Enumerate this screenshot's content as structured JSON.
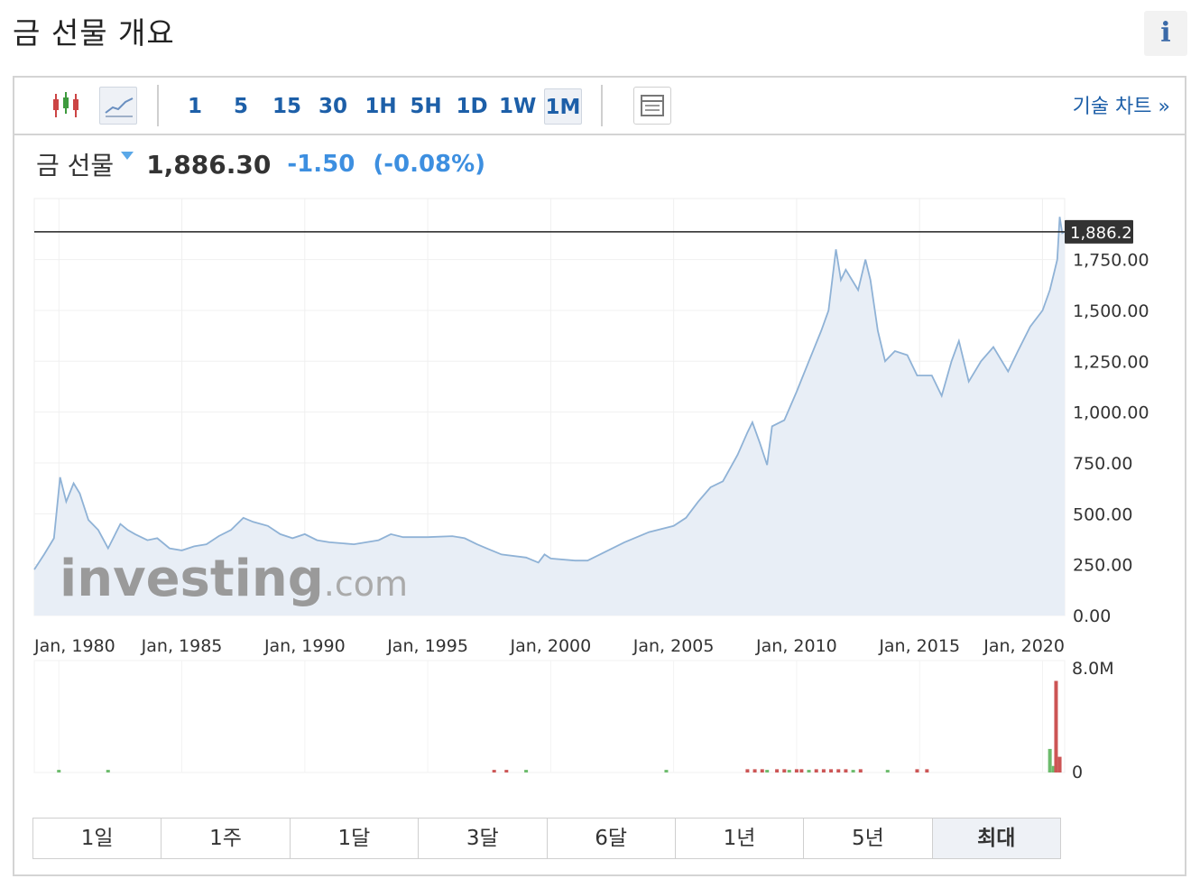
{
  "page": {
    "title": "금 선물 개요",
    "info_icon": "i"
  },
  "toolbar": {
    "timeframes": [
      "1",
      "5",
      "15",
      "30",
      "1H",
      "5H",
      "1D",
      "1W",
      "1M"
    ],
    "active_timeframe": "1M",
    "technical_link": "기술 차트 »",
    "icons": [
      "candlestick-icon",
      "line-chart-icon",
      "table-icon"
    ]
  },
  "quote": {
    "name": "금 선물",
    "price": "1,886.30",
    "change": "-1.50",
    "change_pct": "(-0.08%)"
  },
  "watermark": {
    "brand": "investing",
    "suffix": ".com"
  },
  "ranges": [
    "1일",
    "1주",
    "1달",
    "3달",
    "6달",
    "1년",
    "5년",
    "최대"
  ],
  "active_range": "최대",
  "colors": {
    "line": "#8fb2d6",
    "area": "#e8eef6",
    "link": "#1d5fa8",
    "change": "#3d8fe0",
    "vol_up": "#6cbb6c",
    "vol_down": "#cc5555"
  },
  "chart_data": {
    "type": "area",
    "current_value_label": "1,886.25",
    "current_value": 1886.25,
    "x_tick_labels": [
      "Jan, 1980",
      "Jan, 1985",
      "Jan, 1990",
      "Jan, 1995",
      "Jan, 2000",
      "Jan, 2005",
      "Jan, 2010",
      "Jan, 2015",
      "Jan, 2020"
    ],
    "y_tick_labels": [
      "0.00",
      "250.00",
      "500.00",
      "750.00",
      "1,000.00",
      "1,250.00",
      "1,500.00",
      "1,750.00"
    ],
    "ylim": [
      0,
      2050
    ],
    "xlim": [
      1979.0,
      2020.9
    ],
    "series": [
      {
        "x": [
          1979.0,
          1979.4,
          1979.8,
          1980.05,
          1980.3,
          1980.6,
          1980.85,
          1981.2,
          1981.6,
          1982.0,
          1982.5,
          1982.8,
          1983.1,
          1983.6,
          1984.0,
          1984.5,
          1985.0,
          1985.5,
          1986.0,
          1986.5,
          1987.0,
          1987.5,
          1987.9,
          1988.5,
          1989.0,
          1989.5,
          1990.0,
          1990.5,
          1991.0,
          1992.0,
          1993.0,
          1993.5,
          1994.0,
          1995.0,
          1996.0,
          1996.5,
          1997.0,
          1997.5,
          1998.0,
          1999.0,
          1999.5,
          1999.75,
          2000.0,
          2001.0,
          2001.5,
          2002.0,
          2003.0,
          2004.0,
          2005.0,
          2005.5,
          2006.0,
          2006.5,
          2007.0,
          2007.6,
          2008.0,
          2008.2,
          2008.5,
          2008.8,
          2009.0,
          2009.5,
          2010.0,
          2010.5,
          2011.0,
          2011.3,
          2011.6,
          2011.8,
          2012.0,
          2012.5,
          2012.8,
          2013.0,
          2013.3,
          2013.6,
          2014.0,
          2014.5,
          2014.9,
          2015.5,
          2015.9,
          2016.3,
          2016.6,
          2017.0,
          2017.5,
          2018.0,
          2018.6,
          2019.0,
          2019.5,
          2020.0,
          2020.3,
          2020.5,
          2020.6,
          2020.7,
          2020.8,
          2020.9
        ],
        "y": [
          226,
          300,
          380,
          680,
          560,
          650,
          600,
          470,
          420,
          330,
          450,
          420,
          400,
          370,
          380,
          330,
          320,
          340,
          350,
          390,
          420,
          480,
          460,
          440,
          400,
          380,
          400,
          370,
          360,
          350,
          370,
          400,
          385,
          385,
          390,
          380,
          350,
          325,
          300,
          285,
          260,
          300,
          280,
          270,
          270,
          300,
          360,
          410,
          440,
          480,
          560,
          630,
          660,
          790,
          900,
          950,
          850,
          740,
          930,
          960,
          1100,
          1250,
          1400,
          1500,
          1800,
          1650,
          1700,
          1600,
          1750,
          1650,
          1400,
          1250,
          1300,
          1280,
          1180,
          1180,
          1080,
          1250,
          1350,
          1150,
          1250,
          1320,
          1200,
          1300,
          1420,
          1500,
          1600,
          1700,
          1750,
          1960,
          1880,
          1886
        ]
      }
    ],
    "volume": {
      "ylim": [
        0,
        8000000
      ],
      "tick_labels": [
        "8.0M",
        "0"
      ],
      "up_x": [
        1980.0,
        1982.0,
        1999.0,
        2004.7,
        2008.8,
        2009.7,
        2010.5,
        2012.3,
        2013.7,
        2020.3,
        2020.45
      ],
      "up_v": [
        200000,
        200000,
        200000,
        200000,
        200000,
        200000,
        200000,
        200000,
        200000,
        1800000,
        500000
      ],
      "down_x": [
        1997.7,
        1998.2,
        2008.0,
        2008.3,
        2008.6,
        2009.2,
        2009.5,
        2010.0,
        2010.2,
        2010.8,
        2011.1,
        2011.4,
        2011.7,
        2012.0,
        2012.6,
        2014.9,
        2015.3,
        2020.55,
        2020.7
      ],
      "down_v": [
        200000,
        200000,
        250000,
        250000,
        250000,
        250000,
        250000,
        250000,
        250000,
        250000,
        250000,
        250000,
        250000,
        250000,
        250000,
        250000,
        250000,
        7000000,
        1200000
      ]
    }
  }
}
